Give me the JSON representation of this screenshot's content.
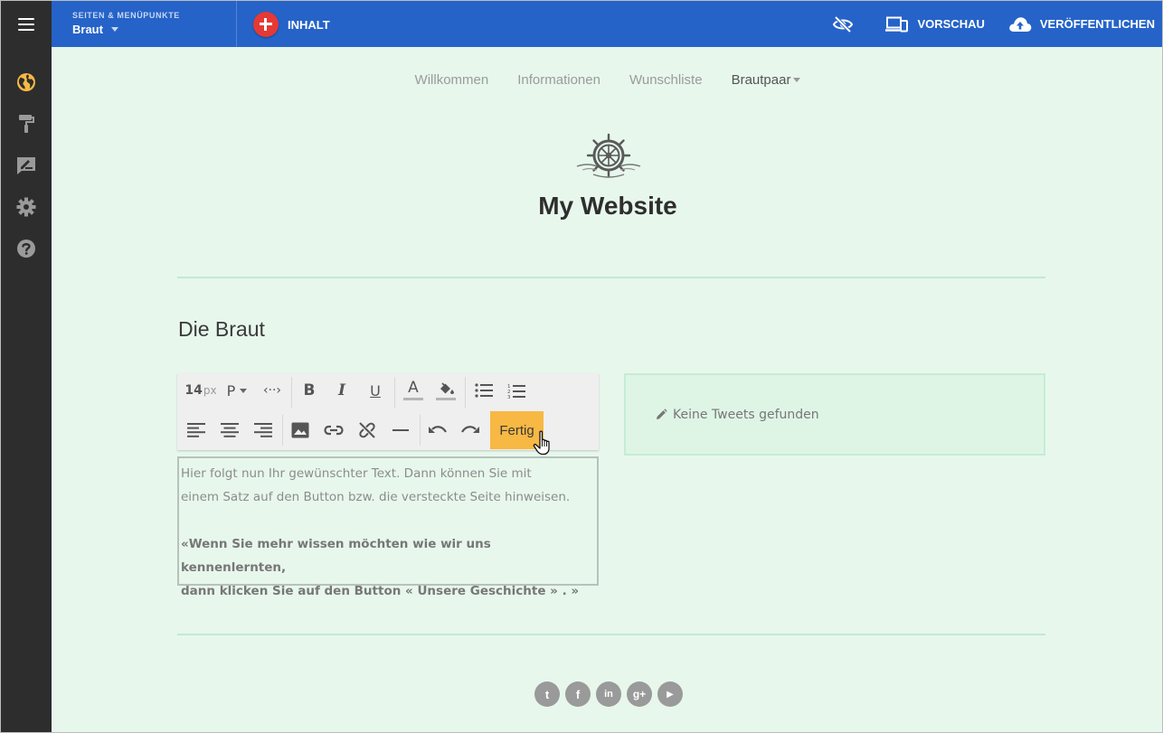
{
  "topbar": {
    "pages_label": "SEITEN & MENÜPUNKTE",
    "current_page": "Braut",
    "add_content_label": "INHALT",
    "preview_label": "VORSCHAU",
    "publish_label": "VERÖFFENTLICHEN",
    "icons": [
      "menu-icon",
      "visibility-off-icon",
      "devices-icon",
      "cloud-upload-icon"
    ]
  },
  "sidebar": {
    "items": [
      {
        "icon": "globe-icon",
        "active": true
      },
      {
        "icon": "paint-roller-icon",
        "active": false
      },
      {
        "icon": "edit-note-icon",
        "active": false
      },
      {
        "icon": "gear-icon",
        "active": false
      },
      {
        "icon": "help-icon",
        "active": false
      }
    ],
    "active_color": "#f7b844"
  },
  "site": {
    "nav": [
      {
        "label": "Willkommen"
      },
      {
        "label": "Informationen"
      },
      {
        "label": "Wunschliste"
      },
      {
        "label": "Brautpaar"
      }
    ],
    "title": "My Website",
    "section_title": "Die Braut"
  },
  "editor": {
    "font_size": "14",
    "font_unit": "px",
    "paragraph_label": "P",
    "code_label": "‹··›",
    "bold_label": "B",
    "italic_label": "I",
    "underline_label": "U",
    "font_color_label": "A",
    "done_label": "Fertig",
    "text_line1": "Hier folgt nun Ihr gewünschter Text. Dann können Sie mit",
    "text_line2": "einem Satz auf den Button bzw. die versteckte Seite hinweisen.",
    "bold_line1": "«Wenn Sie mehr wissen möchten wie wir uns kennenlernten,",
    "bold_line2": "dann klicken Sie auf den Button « Unsere Geschichte » . »"
  },
  "tweets": {
    "message": "Keine Tweets gefunden"
  },
  "socials": [
    {
      "icon": "twitter-icon",
      "glyph": "t"
    },
    {
      "icon": "facebook-icon",
      "glyph": "f"
    },
    {
      "icon": "linkedin-icon",
      "glyph": "in"
    },
    {
      "icon": "google-plus-icon",
      "glyph": "g+"
    },
    {
      "icon": "youtube-icon",
      "glyph": "▶"
    }
  ],
  "colors": {
    "topbar": "#2563c8",
    "sidebar": "#2d2d2d",
    "background": "#e7f7ec",
    "accent": "#f7b844",
    "add_button": "#e53935"
  }
}
